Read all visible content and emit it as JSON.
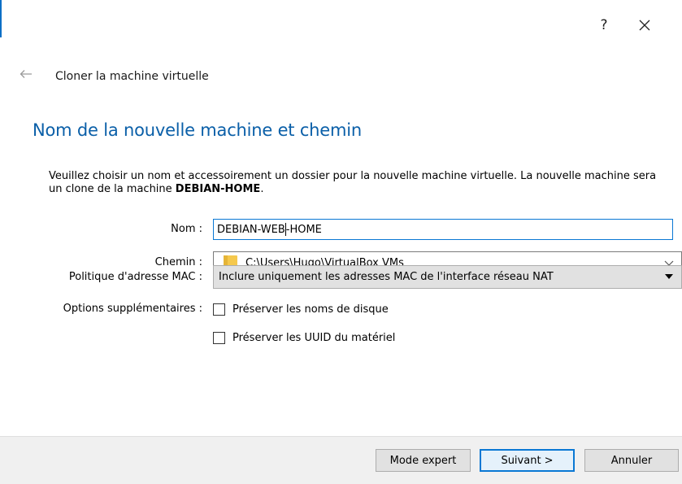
{
  "window": {
    "help_label": "?",
    "close_icon": "close-icon"
  },
  "header": {
    "back_icon": "back-arrow-icon",
    "title": "Cloner la machine virtuelle"
  },
  "page": {
    "title": "Nom de la nouvelle machine et chemin",
    "description_pre": "Veuillez choisir un nom et accessoirement un dossier pour la nouvelle machine virtuelle. La nouvelle machine sera un clone de la machine ",
    "description_machine": "DEBIAN-HOME",
    "description_post": "."
  },
  "form": {
    "name": {
      "label": "Nom :",
      "value_before_caret": "DEBIAN-WEB",
      "value_after_caret": "-HOME"
    },
    "path": {
      "label": "Chemin :",
      "value": "C:\\Users\\Hugo\\VirtualBox VMs",
      "icon": "folder-icon"
    },
    "mac_policy": {
      "label": "Politique d'adresse MAC :",
      "selected": "Inclure uniquement les adresses MAC de l'interface réseau NAT"
    },
    "options": {
      "label": "Options supplémentaires :",
      "items": [
        {
          "label": "Préserver les noms de disque",
          "checked": false
        },
        {
          "label": "Préserver les UUID du matériel",
          "checked": false
        }
      ]
    }
  },
  "buttons": {
    "expert": "Mode expert",
    "next": "Suivant >",
    "cancel": "Annuler"
  },
  "colors": {
    "accent": "#0a78d4",
    "title_blue": "#0a5fa8",
    "footer_bg": "#f0f0f0",
    "button_bg": "#e1e1e1",
    "folder_yellow": "#f5c84c"
  }
}
